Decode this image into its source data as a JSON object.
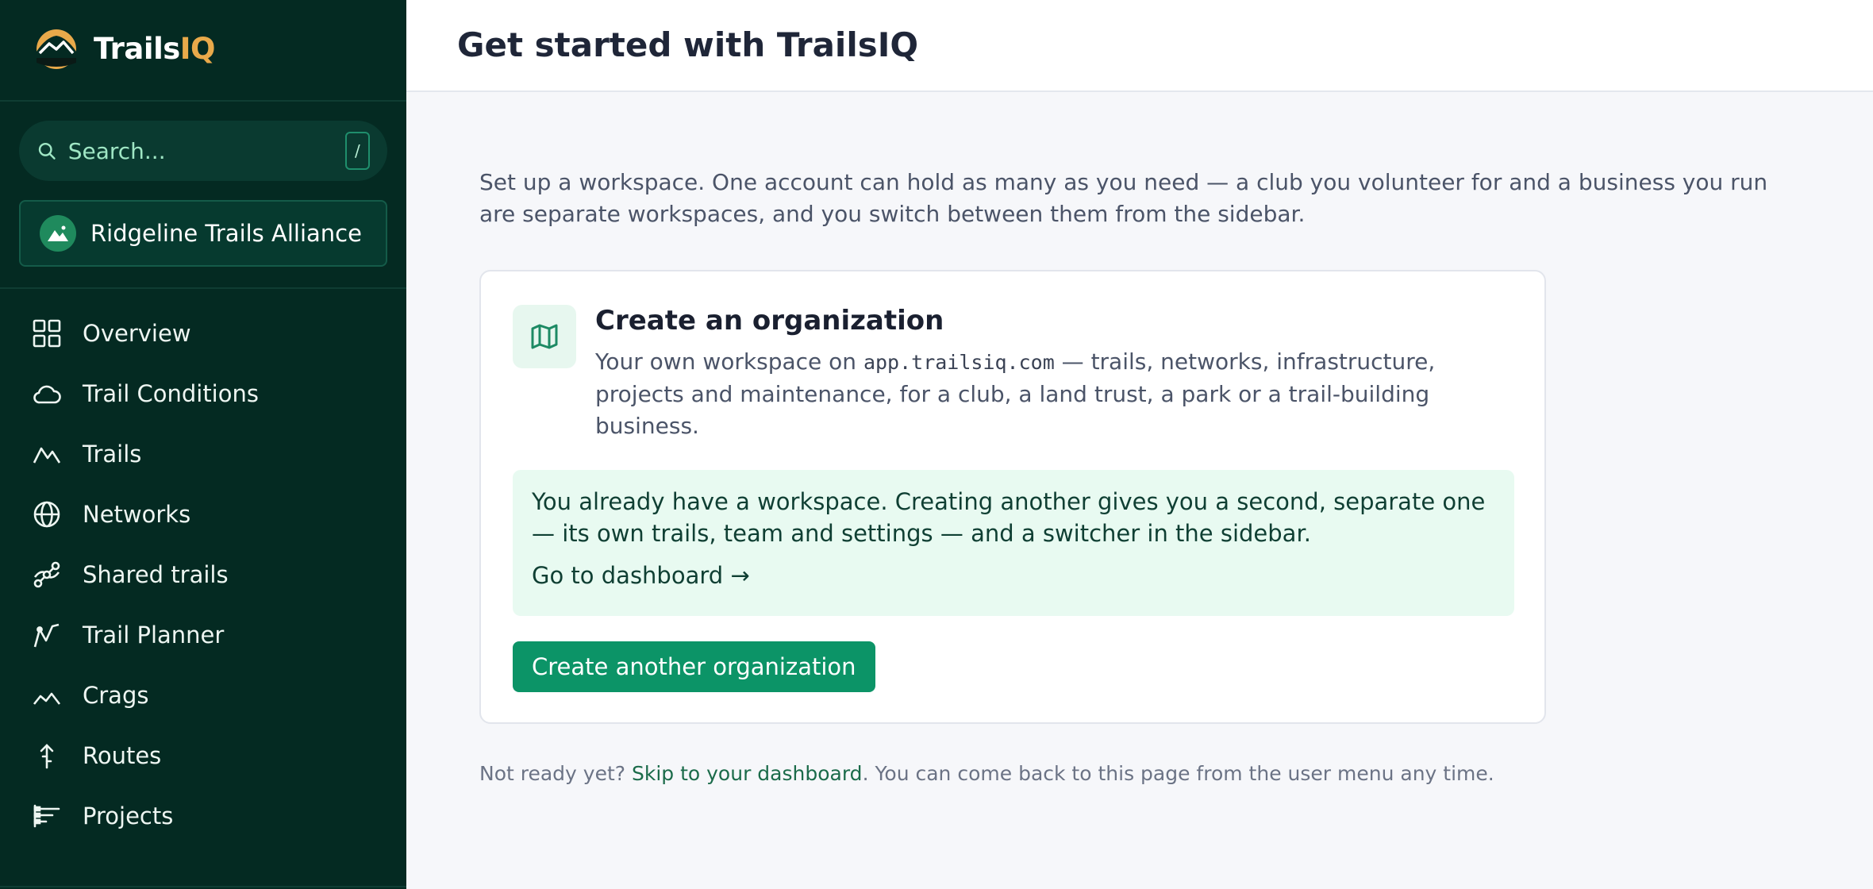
{
  "brand": {
    "name_main": "Trails",
    "name_accent": "IQ"
  },
  "search": {
    "placeholder": "Search...",
    "shortcut": "/"
  },
  "org": {
    "name": "Ridgeline Trails Alliance"
  },
  "nav": [
    {
      "label": "Overview",
      "icon": "grid-icon"
    },
    {
      "label": "Trail Conditions",
      "icon": "cloud-icon"
    },
    {
      "label": "Trails",
      "icon": "mountain-icon"
    },
    {
      "label": "Networks",
      "icon": "globe-icon"
    },
    {
      "label": "Shared trails",
      "icon": "link-nodes-icon"
    },
    {
      "label": "Trail Planner",
      "icon": "route-planner-icon"
    },
    {
      "label": "Crags",
      "icon": "crag-icon"
    },
    {
      "label": "Routes",
      "icon": "climb-route-icon"
    },
    {
      "label": "Projects",
      "icon": "list-icon"
    }
  ],
  "header": {
    "title": "Get started with TrailsIQ"
  },
  "intro": "Set up a workspace. One account can hold as many as you need — a club you volunteer for and a business you run are separate workspaces, and you switch between them from the sidebar.",
  "card": {
    "icon": "map-icon",
    "title": "Create an organization",
    "desc_before": "Your own workspace on ",
    "desc_domain": "app.trailsiq.com",
    "desc_after": " — trails, networks, infrastructure, projects and maintenance, for a club, a land trust, a park or a trail-building business.",
    "notice_text": "You already have a workspace. Creating another gives you a second, separate one — its own trails, team and settings — and a switcher in the sidebar.",
    "notice_link": "Go to dashboard →",
    "button": "Create another organization"
  },
  "footer": {
    "before": "Not ready yet? ",
    "link": "Skip to your dashboard",
    "after": ". You can come back to this page from the user menu any time."
  },
  "colors": {
    "sidebar_bg": "#042a22",
    "brand_accent": "#e9a94a",
    "primary_button": "#0c9467",
    "notice_bg": "#e8faf1"
  }
}
